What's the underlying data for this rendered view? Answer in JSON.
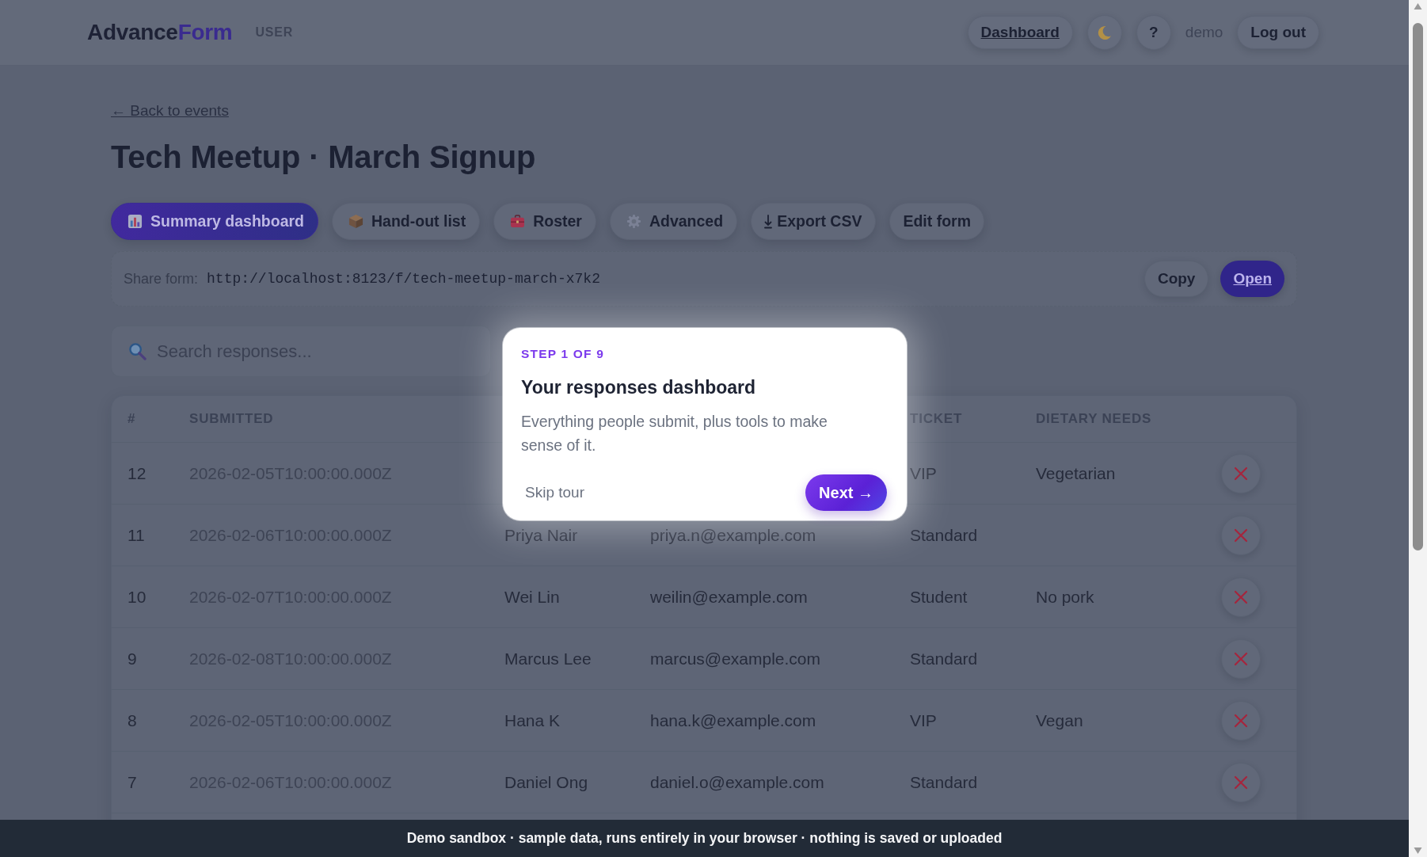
{
  "header": {
    "logo": [
      "Advance",
      "Form"
    ],
    "role": "USER",
    "dashboard_link": "Dashboard",
    "help_button": "?",
    "user": "demo",
    "logout_button": "Log out"
  },
  "back_link": "← Back to events",
  "title": "Tech Meetup · March Signup",
  "tabs": [
    {
      "label": "Summary dashboard",
      "selected": true
    },
    {
      "label": "Hand-out list",
      "selected": false
    },
    {
      "label": "Roster",
      "selected": false
    },
    {
      "label": "Advanced",
      "selected": false
    },
    {
      "label": "Export CSV",
      "selected": false
    },
    {
      "label": "Edit form",
      "selected": false
    }
  ],
  "share": {
    "label": "Share form:",
    "url": "http://localhost:8123/f/tech-meetup-march-x7k2",
    "copy_button": "Copy",
    "open_button": "Open"
  },
  "search": {
    "placeholder": "Search responses..."
  },
  "tour": {
    "step": "STEP 1 OF 9",
    "title": "Your responses dashboard",
    "body": "Everything people submit, plus tools to make sense of it.",
    "skip_button": "Skip tour",
    "next_button": "Next →"
  },
  "table": {
    "columns": [
      "#",
      "SUBMITTED",
      null,
      null,
      "TICKET",
      "DIETARY NEEDS"
    ],
    "rows": [
      {
        "cells": [
          "12",
          "2026-02-05T10:00:00.000Z",
          null,
          null,
          "VIP",
          "Vegetarian"
        ]
      },
      {
        "cells": [
          "11",
          "2026-02-06T10:00:00.000Z",
          "Priya Nair",
          "priya.n@example.com",
          "Standard",
          null
        ]
      },
      {
        "cells": [
          "10",
          "2026-02-07T10:00:00.000Z",
          "Wei Lin",
          "weilin@example.com",
          "Student",
          "No pork"
        ]
      },
      {
        "cells": [
          "9",
          "2026-02-08T10:00:00.000Z",
          "Marcus Lee",
          "marcus@example.com",
          "Standard",
          null
        ]
      },
      {
        "cells": [
          "8",
          "2026-02-05T10:00:00.000Z",
          "Hana K",
          "hana.k@example.com",
          "VIP",
          "Vegan"
        ]
      },
      {
        "cells": [
          "7",
          "2026-02-06T10:00:00.000Z",
          "Daniel Ong",
          "daniel.o@example.com",
          "Standard",
          null
        ]
      }
    ]
  },
  "banner": "Demo sandbox · sample data, runs entirely in your browser · nothing is saved or uploaded"
}
